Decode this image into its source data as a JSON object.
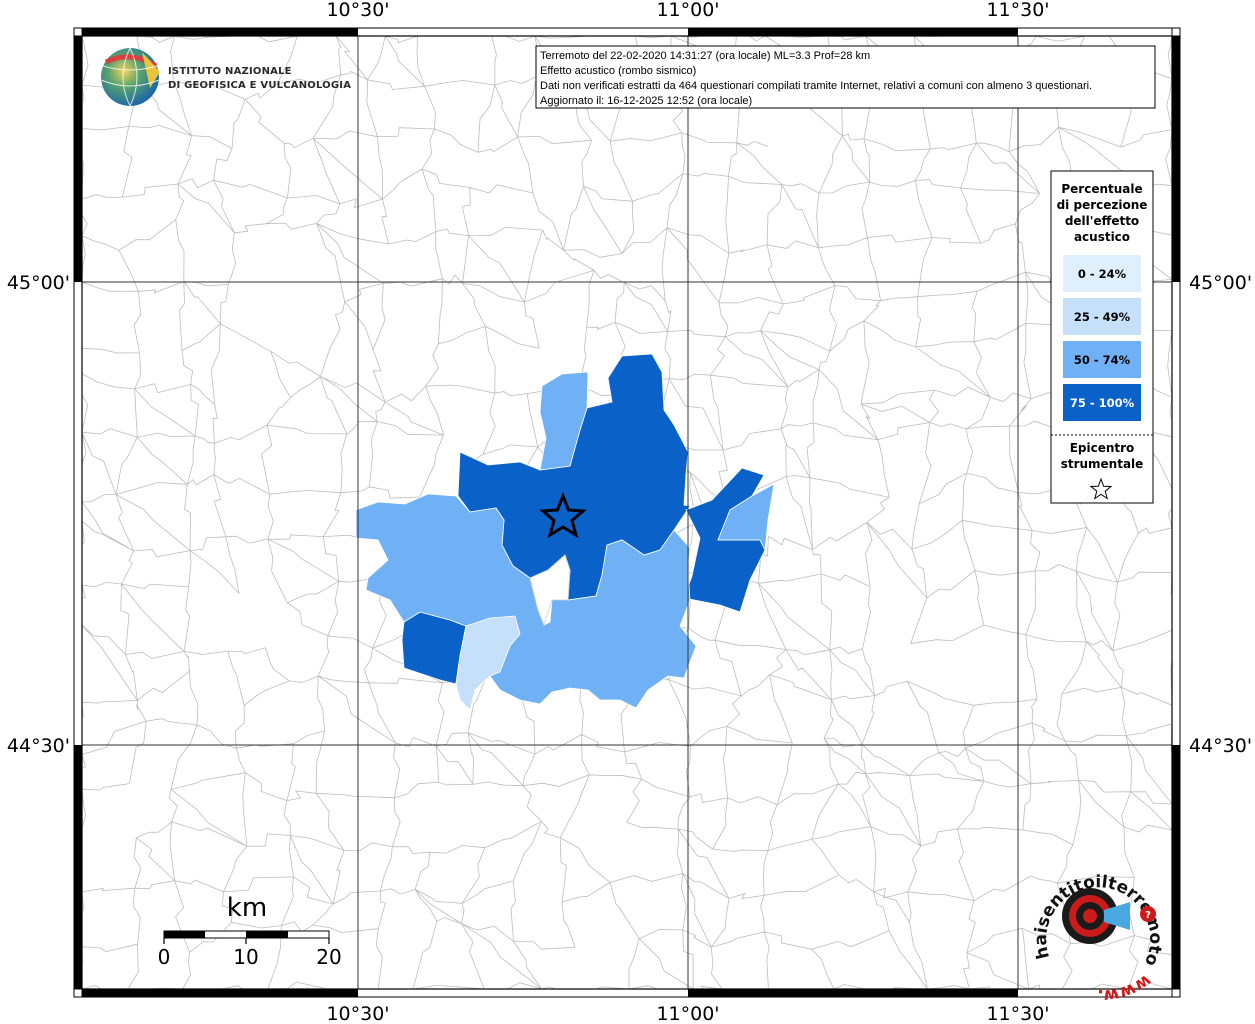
{
  "info": {
    "lines": [
      "Terremoto del 22-02-2020 14:31:27 (ora locale) ML=3.3 Prof=28 km",
      "Effetto acustico (rombo sismico)",
      "Dati non verificati estratti da 464 questionari compilati tramite Internet, relativi a comuni con almeno 3 questionari.",
      "Aggiornato il: 16-12-2025 12:52 (ora locale)"
    ]
  },
  "institute": {
    "line1": "ISTITUTO NAZIONALE",
    "line2": "DI GEOFISICA E VULCANOLOGIA"
  },
  "axes": {
    "top_ticks": [
      "10°30'",
      "11°00'",
      "11°30'"
    ],
    "bottom_ticks": [
      "10°30'",
      "11°00'",
      "11°30'"
    ],
    "left_ticks": [
      "45°00'",
      "44°30'"
    ],
    "right_ticks": [
      "45°00'",
      "44°30'"
    ]
  },
  "legend": {
    "title_lines": [
      "Percentuale",
      "di percezione",
      "dell'effetto",
      "acustico"
    ],
    "classes": [
      {
        "label": "0 - 24%",
        "color": "#dff0fc",
        "text_color": "#000000"
      },
      {
        "label": "25 - 49%",
        "color": "#c6e0fa",
        "text_color": "#000000"
      },
      {
        "label": "50 - 74%",
        "color": "#70b0f5",
        "text_color": "#000000"
      },
      {
        "label": "75 - 100%",
        "color": "#0a62c9",
        "text_color": "#ffffff"
      }
    ],
    "epicenter_lines": [
      "Epicentro",
      "strumentale"
    ]
  },
  "scale_bar": {
    "unit": "km",
    "labels": [
      "0",
      "10",
      "20"
    ]
  },
  "badge": {
    "text": "haisentitoilterremoto.it",
    "www": "www."
  }
}
